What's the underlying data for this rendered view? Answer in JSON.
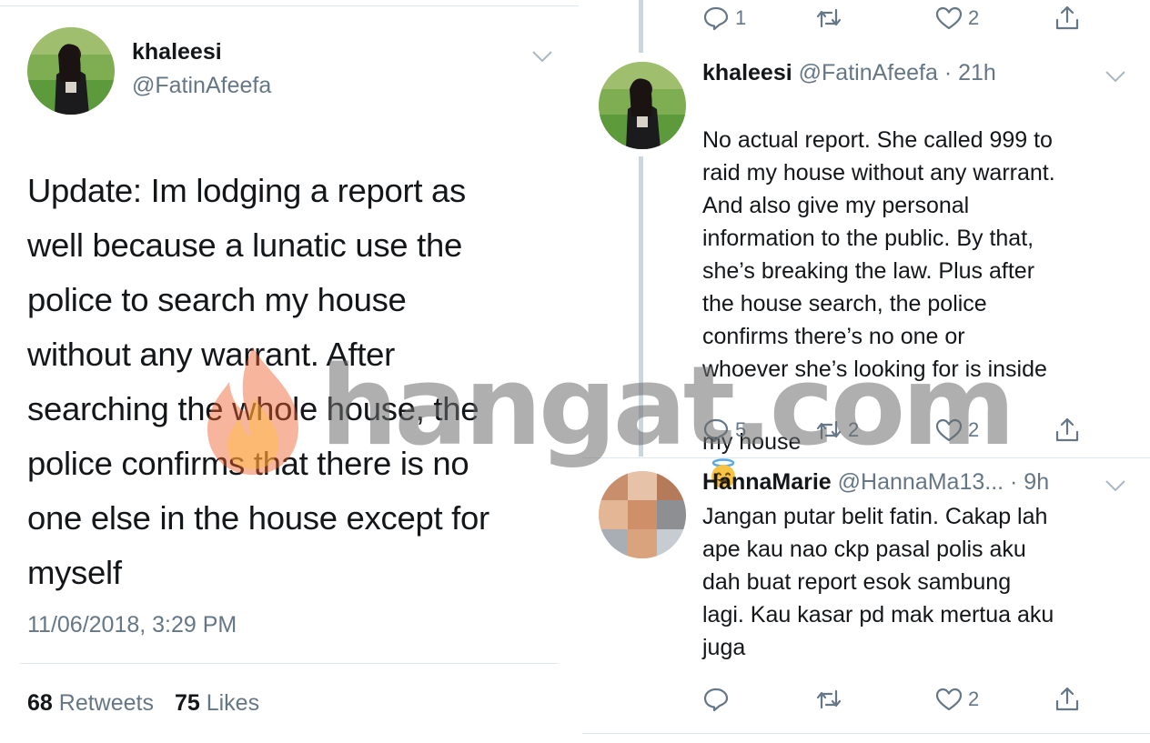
{
  "left_tweet": {
    "display_name": "khaleesi",
    "handle": "@FatinAfeefa",
    "text": "Update: Im lodging a report as\nwell because a lunatic use the\npolice to search my house\nwithout any warrant. After\nsearching the whole house, the\npolice confirms that there is no\none else in the house except for\nmyself",
    "timestamp": "11/06/2018, 3:29 PM",
    "retweets_count": "68",
    "retweets_label": "Retweets",
    "likes_count": "75",
    "likes_label": "Likes"
  },
  "top_actions": {
    "reply_count": "1",
    "retweet_count": "",
    "like_count": "2"
  },
  "reply_1": {
    "display_name": "khaleesi",
    "handle_time": "@FatinAfeefa · 21h",
    "text": "No actual report. She called 999 to\nraid my house without any warrant.\nAnd also give my personal\ninformation to the public. By that,\nshe’s breaking the law. Plus after\nthe house search, the police\nconfirms there’s no one or\nwhoever she’s looking for is inside",
    "last_line": "my house",
    "reply_count": "5",
    "retweet_count": "2",
    "like_count": "2"
  },
  "reply_2": {
    "display_name": "HannaMarie",
    "handle_time": "@HannaMa13... · 9h",
    "text": "Jangan putar belit fatin. Cakap lah\nape kau nao ckp pasal polis aku\ndah buat report esok sambung\nlagi. Kau kasar pd mak mertua aku\njuga",
    "reply_count": "",
    "retweet_count": "",
    "like_count": "2"
  },
  "watermark": {
    "text": "hangat.com"
  },
  "colors": {
    "text_primary": "#14171a",
    "text_secondary": "#657786",
    "divider": "#e1e8ed",
    "thread_line": "#ccd6dd"
  }
}
